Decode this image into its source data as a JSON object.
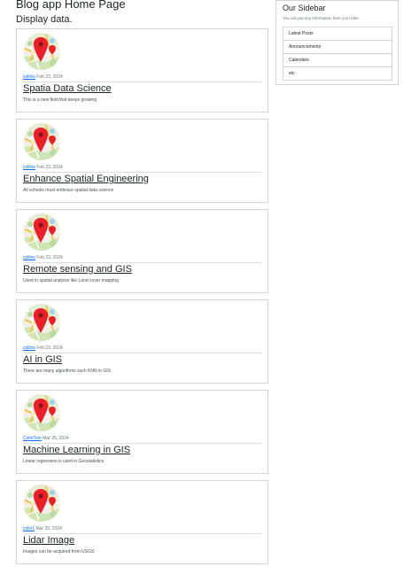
{
  "header": {
    "title": "Blog app Home Page",
    "subtitle": "Display data."
  },
  "posts": [
    {
      "author": "collins",
      "date": "Feb 23, 2024",
      "title": "Spatia Data Science",
      "body": "This is a new field that keeps growing"
    },
    {
      "author": "collins",
      "date": "Feb 23, 2024",
      "title": "Enhance Spatial Engineering",
      "body": "All schools must embrace spatial data science"
    },
    {
      "author": "collins",
      "date": "Feb 23, 2024",
      "title": "Remote sensing and GIS",
      "body": "Used in spatial analysis like Land cover mapping"
    },
    {
      "author": "collins",
      "date": "Feb 23, 2024",
      "title": "AI in GIS",
      "body": "There are many algorithms such KNN in GIS"
    },
    {
      "author": "ColinTom",
      "date": "Mar 25, 2024",
      "title": "Machine Learning in GIS",
      "body": "Linear regression is used in Geostatistics"
    },
    {
      "author": "colin1",
      "date": "Mar 25, 2024",
      "title": "Lidar Image",
      "body": "Images can be acquired from USGS"
    }
  ],
  "sidebar": {
    "title": "Our Sidebar",
    "text": "You can put any information here you'd like.",
    "items": [
      "Latest Posts",
      "Announcements",
      "Calendars",
      "etc"
    ]
  },
  "icons": {
    "post_thumbnail": "map-pin-icon"
  },
  "colors": {
    "link": "#0d6efd",
    "pin": "#e8202a",
    "border": "#d4d4d4"
  }
}
